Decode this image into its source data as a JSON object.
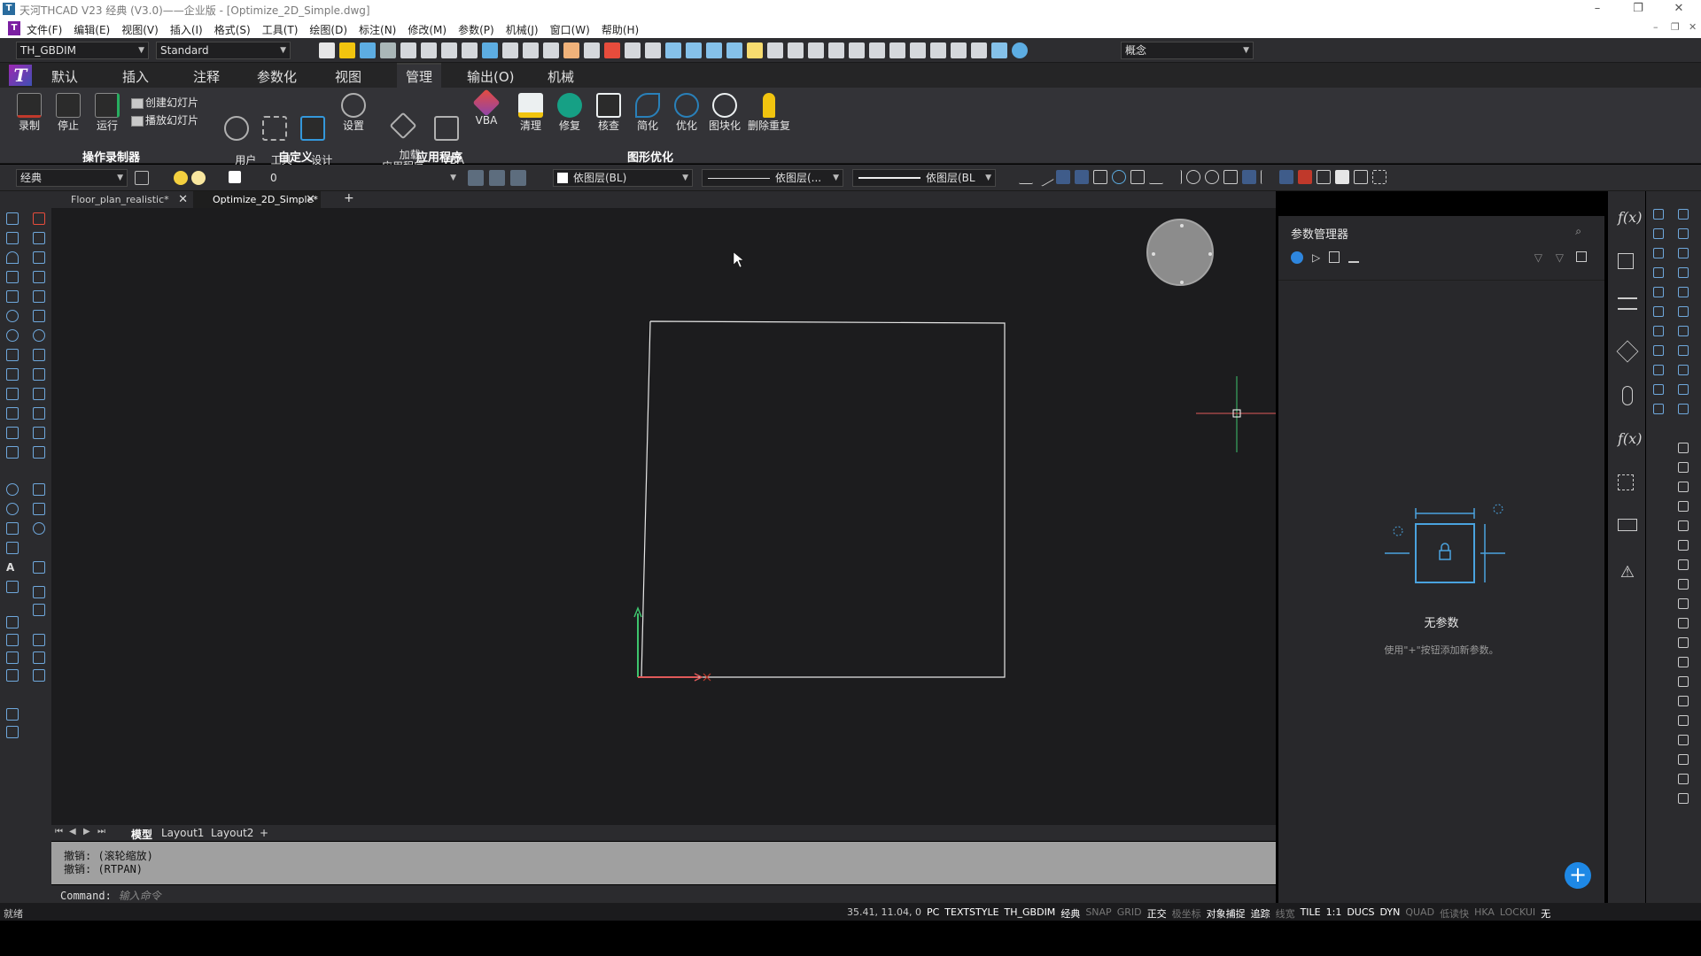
{
  "window": {
    "title": "天河THCAD V23 经典 (V3.0)——企业版 - [Optimize_2D_Simple.dwg]",
    "app_icon": "T",
    "min": "–",
    "restore": "❐",
    "close": "✕"
  },
  "menu": {
    "logo": "T",
    "items": [
      "文件(F)",
      "编辑(E)",
      "视图(V)",
      "插入(I)",
      "格式(S)",
      "工具(T)",
      "绘图(D)",
      "标注(N)",
      "修改(M)",
      "参数(P)",
      "机械(J)",
      "窗口(W)",
      "帮助(H)"
    ]
  },
  "toolbar1": {
    "style_combo": "TH_GBDIM",
    "text_style_combo": "Standard",
    "visual_style_combo": "概念"
  },
  "ribbon": {
    "tabs": [
      "默认",
      "插入",
      "注释",
      "参数化",
      "视图",
      "管理",
      "输出(O)",
      "机械"
    ],
    "active_tab": "管理",
    "buttons": [
      {
        "label": "录制",
        "color": "#c0392b"
      },
      {
        "label": "停止",
        "color": "#7f8c8d"
      },
      {
        "label": "运行",
        "color": "#27ae60"
      },
      {
        "label": "用户\n界面",
        "color": "#95a5a6"
      },
      {
        "label": "工具\n选项板",
        "color": "#bdc3c7"
      },
      {
        "label": "设计\n中心",
        "color": "#3498db"
      },
      {
        "label": "设置",
        "color": "#95a5a6"
      },
      {
        "label": "加载\n应用程序",
        "color": "#bdc3c7"
      },
      {
        "label": "VBA\n管理器",
        "color": "#bdc3c7"
      },
      {
        "label": "VBA",
        "color": "#e74c3c"
      },
      {
        "label": "清理",
        "color": "#f1c40f"
      },
      {
        "label": "修复",
        "color": "#16a085"
      },
      {
        "label": "核查",
        "color": "#ecf0f1"
      },
      {
        "label": "简化",
        "color": "#2980b9"
      },
      {
        "label": "优化",
        "color": "#2980b9"
      },
      {
        "label": "图块化",
        "color": "#ecf0f1"
      },
      {
        "label": "删除重复",
        "color": "#f1c40f"
      }
    ],
    "slide_create": "创建幻灯片",
    "slide_play": "播放幻灯片",
    "groups": [
      "操作录制器",
      "自定义",
      "应用程序",
      "图形优化"
    ]
  },
  "toolbar2": {
    "workspace": "经典",
    "layer": "0",
    "color": "依图层(BL)",
    "linetype": "依图层(...",
    "lineweight": "依图层(BL"
  },
  "doc_tabs": [
    {
      "label": "Floor_plan_realistic*",
      "active": false
    },
    {
      "label": "Optimize_2D_Simple*",
      "active": true
    }
  ],
  "doc_tab_close": "✕",
  "doc_tab_add": "+",
  "layout_tabs": [
    "模型",
    "Layout1",
    "Layout2",
    "+"
  ],
  "command": {
    "history": [
      "撤销:  (滚轮缩放)",
      "撤销:  (RTPAN)"
    ],
    "prompt": "Command:",
    "placeholder": "输入命令"
  },
  "param_manager": {
    "title": "参数管理器",
    "empty_title": "无参数",
    "empty_hint": "使用\"+\"按钮添加新参数。",
    "add": "+"
  },
  "side_strip": {
    "fx": "f(x)"
  },
  "status": {
    "left": "就绪",
    "coords": "35.41, 11.04, 0",
    "toggles": [
      {
        "label": "PC",
        "on": true
      },
      {
        "label": "TEXTSTYLE",
        "on": true
      },
      {
        "label": "TH_GBDIM",
        "on": true
      },
      {
        "label": "经典",
        "on": true
      },
      {
        "label": "SNAP",
        "on": false
      },
      {
        "label": "GRID",
        "on": false
      },
      {
        "label": "正交",
        "on": true
      },
      {
        "label": "极坐标",
        "on": false
      },
      {
        "label": "对象捕捉",
        "on": true
      },
      {
        "label": "追踪",
        "on": true
      },
      {
        "label": "线宽",
        "on": false
      },
      {
        "label": "TILE",
        "on": true
      },
      {
        "label": "1:1",
        "on": true
      },
      {
        "label": "DUCS",
        "on": true
      },
      {
        "label": "DYN",
        "on": true
      },
      {
        "label": "QUAD",
        "on": false
      },
      {
        "label": "低读快",
        "on": false
      },
      {
        "label": "HKA",
        "on": false
      },
      {
        "label": "LOCKUI",
        "on": false
      },
      {
        "label": "无",
        "on": true
      }
    ]
  },
  "colors": {
    "canvas_bg": "#1c1c1e",
    "ucs_x": "#e05a5a",
    "ucs_y": "#3ec46d",
    "accent": "#1e88e5"
  }
}
